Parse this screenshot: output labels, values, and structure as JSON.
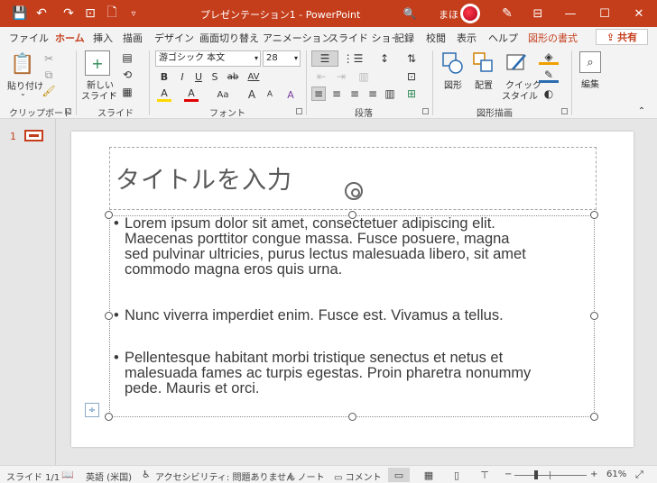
{
  "titlebar": {
    "quick_access": [
      "💾",
      "↶",
      "↷",
      "⊡",
      "🗋",
      "▿"
    ],
    "document": "プレゼンテーション1",
    "separator": "-",
    "app": "PowerPoint",
    "search_icon": "🔍",
    "user": "まほ",
    "pen_icon": "✎",
    "ribbon_display_icon": "⊟",
    "minimize": "—",
    "maximize": "☐",
    "close": "✕",
    "accent_color": "#c43e1c"
  },
  "tabs": [
    "ファイル",
    "ホーム",
    "挿入",
    "描画",
    "デザイン",
    "画面切り替え",
    "アニメーション",
    "スライド ショー",
    "記録",
    "校閲",
    "表示",
    "ヘルプ",
    "図形の書式"
  ],
  "active_tab": "ホーム",
  "share": {
    "label": "共有",
    "icon": "⇪"
  },
  "ribbon": {
    "clipboard": {
      "label": "クリップボード",
      "paste": "貼り付け",
      "paste_arrow": "⌄"
    },
    "slides": {
      "label": "スライド",
      "new_slide": "新しい",
      "new_slide2": "スライド",
      "new_slide_arrow": "⌄"
    },
    "font": {
      "label": "フォント",
      "family": "游ゴシック 本文",
      "size": "28",
      "bold": "B",
      "italic": "I",
      "underline": "U",
      "shadow": "S",
      "strike": "ab",
      "spacing": "AV",
      "highlight": "A",
      "color": "A",
      "case": "Aa",
      "grow": "A",
      "shrink": "A",
      "clear": "A"
    },
    "paragraph": {
      "label": "段落"
    },
    "drawing": {
      "label": "図形描画",
      "shape": "図形",
      "arrange": "配置",
      "quick_style": "クイック",
      "quick_style2": "スタイル"
    },
    "editing": {
      "label": "編集"
    }
  },
  "thumbnails": {
    "slide_number": "1"
  },
  "slide": {
    "title_placeholder": "タイトルを入力",
    "bullet": "•",
    "paragraphs": [
      [
        "Lorem ipsum dolor sit amet, consectetuer adipiscing elit.",
        "Maecenas porttitor congue massa. Fusce posuere, magna",
        "sed pulvinar ultricies, purus lectus malesuada libero, sit amet",
        "commodo magna eros quis urna."
      ],
      [
        "Nunc viverra imperdiet enim. Fusce est. Vivamus a tellus."
      ],
      [
        "Pellentesque habitant morbi tristique senectus et netus et",
        "malesuada fames ac turpis egestas. Proin pharetra nonummy",
        "pede. Mauris et orci."
      ]
    ]
  },
  "statusbar": {
    "slide": "スライド 1/1",
    "language": "英語 (米国)",
    "accessibility": "アクセシビリティ: 問題ありません",
    "notes": "ノート",
    "comments": "コメント",
    "zoom_minus": "−",
    "zoom_plus": "+",
    "zoom_level": "61%",
    "zoom_fraction": 0.61,
    "fit_icon": "⤢"
  }
}
